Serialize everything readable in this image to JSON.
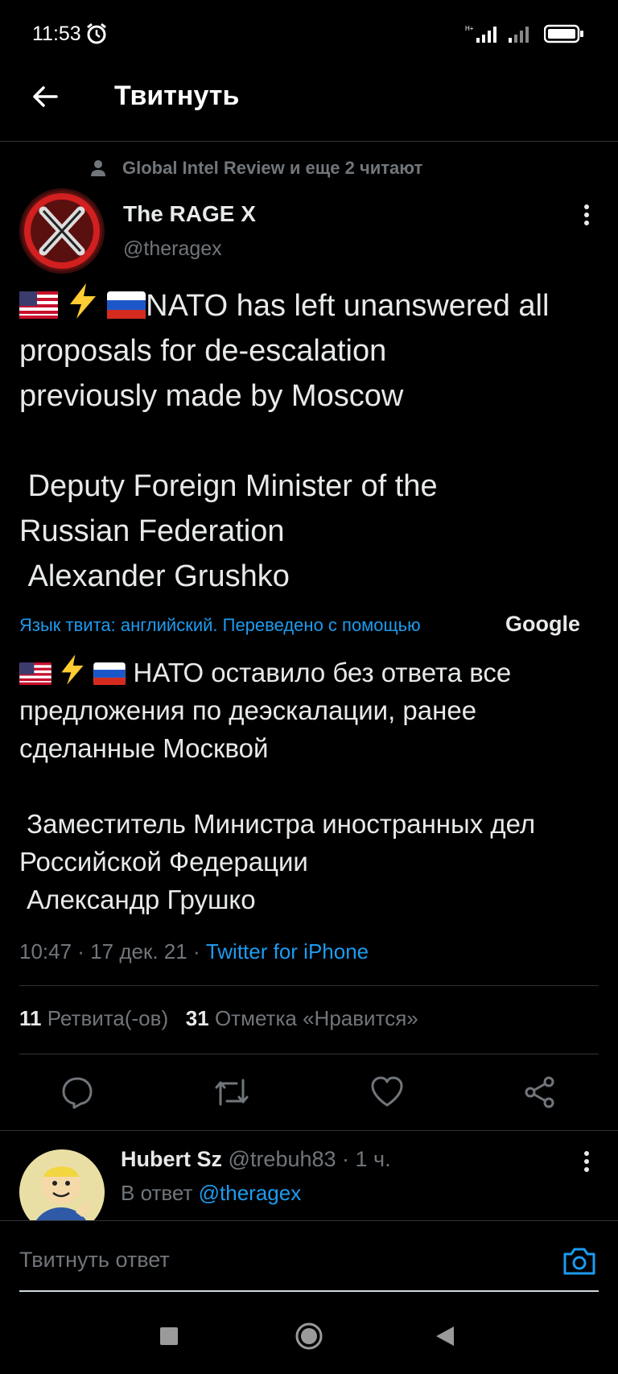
{
  "status_bar": {
    "time": "11:53",
    "net1": "H+"
  },
  "header": {
    "title": "Твитнуть"
  },
  "social_context": "Global Intel Review и еще 2 читают",
  "author": {
    "name": "The RAGE X",
    "handle": "@theragex"
  },
  "tweet": {
    "text_line1": "NATO has left unanswered all",
    "text_rest": "proposals for de-escalation\npreviously made by Moscow\n\n Deputy Foreign Minister of the\nRussian Federation\n Alexander Grushko",
    "translation_notice": "Язык твита: английский. Переведено с помощью",
    "translation_brand": "Google",
    "translated_line1": " НАТО оставило без ответа все",
    "translated_rest": "предложения по деэскалации, ранее\nсделанные Москвой\n\n Заместитель Министра иностранных дел\nРоссийской Федерации\n Александр Грушко",
    "time": "10:47",
    "date": "17 дек. 21",
    "source": "Twitter for iPhone"
  },
  "stats": {
    "retweets_count": "11",
    "retweets_label": "Ретвита(-ов)",
    "likes_count": "31",
    "likes_label": "Отметка «Нравится»"
  },
  "reply": {
    "name": "Hubert Sz",
    "handle": "@trebuh83",
    "time": "1 ч.",
    "replying_to_label": "В ответ",
    "replying_to_handle": "@theragex"
  },
  "compose": {
    "placeholder": "Твитнуть ответ"
  },
  "colors": {
    "accent": "#1d9bf0",
    "secondary": "#71767b",
    "divider": "#2f3336"
  }
}
